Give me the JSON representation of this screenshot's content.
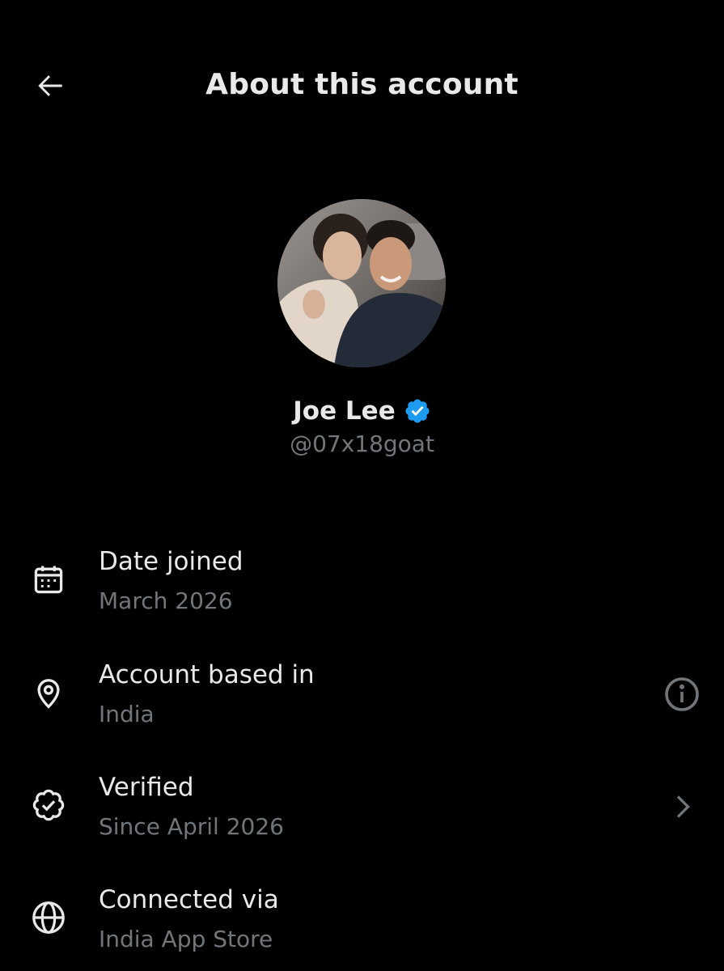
{
  "header": {
    "title": "About this account",
    "back_icon": "arrow-left-icon"
  },
  "profile": {
    "display_name": "Joe Lee",
    "handle": "@07x18goat",
    "verified_badge_icon": "verified-badge-icon",
    "verified_color": "#1d9bf0",
    "avatar": "profile-photo"
  },
  "rows": [
    {
      "icon": "calendar-icon",
      "label": "Date joined",
      "value": "March 2026"
    },
    {
      "icon": "location-pin-icon",
      "label": "Account based in",
      "value": "India",
      "trailing_icon": "info-icon"
    },
    {
      "icon": "verified-seal-icon",
      "label": "Verified",
      "value": "Since April 2026",
      "trailing_icon": "chevron-right-icon"
    },
    {
      "icon": "globe-icon",
      "label": "Connected via",
      "value": "India App Store"
    }
  ],
  "colors": {
    "background": "#000000",
    "primary_text": "#e7e9ea",
    "secondary_text": "#71767b",
    "accent_blue": "#1d9bf0"
  }
}
